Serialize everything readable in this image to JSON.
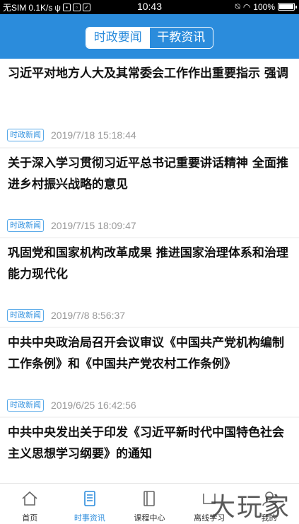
{
  "statusbar": {
    "carrier": "无SIM",
    "speed": "0.1K/s",
    "time": "10:43",
    "battery": "100%"
  },
  "header": {
    "tabs": [
      {
        "label": "时政要闻",
        "active": true
      },
      {
        "label": "干教资讯",
        "active": false
      }
    ]
  },
  "news": [
    {
      "title": "习近平对地方人大及其常委会工作作出重要指示 强调",
      "tag": "时政新闻",
      "date": "2019/7/18 15:18:44"
    },
    {
      "title": "关于深入学习贯彻习近平总书记重要讲话精神 全面推进乡村振兴战略的意见",
      "tag": "时政新闻",
      "date": "2019/7/15 18:09:47"
    },
    {
      "title": "巩固党和国家机构改革成果 推进国家治理体系和治理能力现代化",
      "tag": "时政新闻",
      "date": "2019/7/8 8:56:37"
    },
    {
      "title": "中共中央政治局召开会议审议《中国共产党机构编制工作条例》和《中国共产党农村工作条例》",
      "tag": "时政新闻",
      "date": "2019/6/25 16:42:56"
    },
    {
      "title": "中共中央发出关于印发《习近平新时代中国特色社会主义思想学习纲要》的通知",
      "tag": "",
      "date": ""
    }
  ],
  "bottomnav": [
    {
      "label": "首页",
      "icon": "home-icon",
      "active": false
    },
    {
      "label": "时事资讯",
      "icon": "news-doc-icon",
      "active": true
    },
    {
      "label": "课程中心",
      "icon": "book-icon",
      "active": false
    },
    {
      "label": "离线学习",
      "icon": "offline-icon",
      "active": false
    },
    {
      "label": "我的",
      "icon": "user-icon",
      "active": false
    }
  ],
  "watermark": "大玩家",
  "colors": {
    "primary": "#2b8cdc",
    "tag": "#3593df"
  }
}
